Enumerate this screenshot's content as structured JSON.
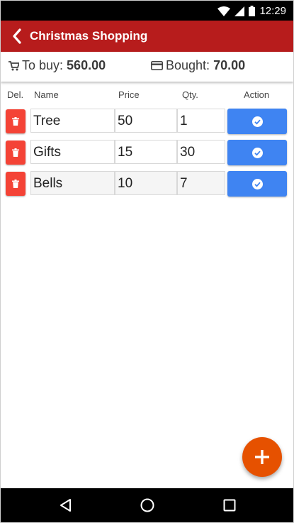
{
  "status_bar": {
    "time": "12:29",
    "icons": [
      "wifi-icon",
      "signal-icon",
      "battery-icon"
    ]
  },
  "app_bar": {
    "title": "Christmas Shopping",
    "back_icon": "chevron-left-icon"
  },
  "summary": {
    "to_buy_label": "To buy:",
    "to_buy_value": "560.00",
    "bought_label": "Bought:",
    "bought_value": "70.00"
  },
  "table": {
    "headers": {
      "del": "Del.",
      "name": "Name",
      "price": "Price",
      "qty": "Qty.",
      "action": "Action"
    },
    "rows": [
      {
        "name": "Tree",
        "price": "50",
        "qty": "1"
      },
      {
        "name": "Gifts",
        "price": "15",
        "qty": "30"
      },
      {
        "name": "Bells",
        "price": "10",
        "qty": "7"
      }
    ]
  },
  "colors": {
    "app_bar": "#b71c1c",
    "delete_button": "#f44336",
    "action_button": "#3f84f2",
    "fab": "#e65100"
  },
  "fab": {
    "icon": "plus-icon"
  }
}
